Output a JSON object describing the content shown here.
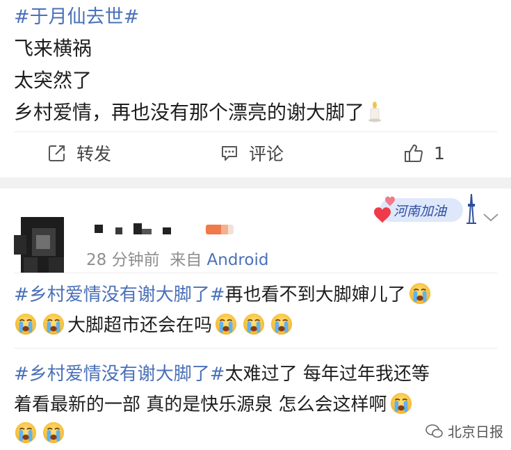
{
  "post": {
    "topic": "#于月仙去世#",
    "lines": [
      "飞来横祸",
      "太突然了",
      "乡村爱情，再也没有那个漂亮的谢大脚了"
    ],
    "candle_icon": "candle-emoji",
    "actions": {
      "forward_label": "转发",
      "comment_label": "评论",
      "like_count": "1"
    }
  },
  "comment_card": {
    "time_ago": "28 分钟前",
    "source_prefix": "来自",
    "source": "Android",
    "decoration_text": "河南加油",
    "comments": [
      {
        "topic": "#乡村爱情没有谢大脚了#",
        "text_line1": "再也看不到大脚婶儿了",
        "text_line2": "大脚超市还会在吗"
      },
      {
        "topic": "#乡村爱情没有谢大脚了#",
        "text_line1": "太难过了 每年过年我还等",
        "text_line2": "着看最新的一部 真的是快乐源泉 怎么会这样啊"
      }
    ],
    "emoji_name": "crying-face-emoji"
  },
  "watermark": "北京日报",
  "colors": {
    "link": "#4a70b8",
    "text": "#1e1e1e",
    "meta": "#8e8e8e",
    "separator": "#f1f1f1"
  }
}
